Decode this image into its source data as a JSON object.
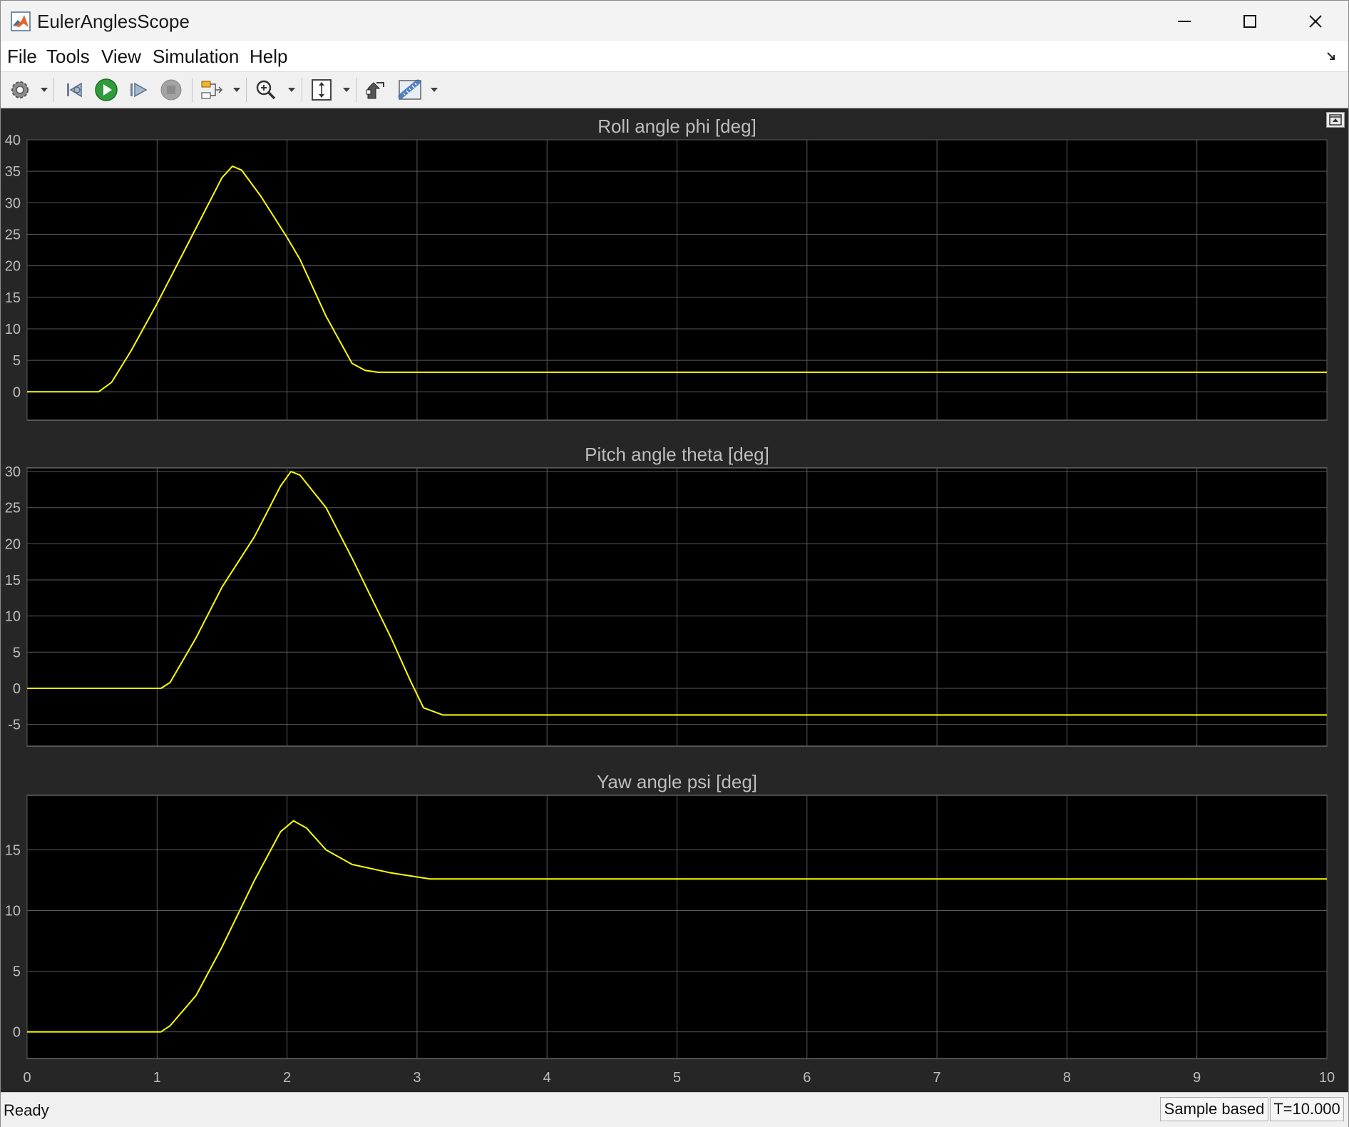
{
  "window": {
    "title": "EulerAnglesScope"
  },
  "menu": {
    "file": "File",
    "tools": "Tools",
    "view": "View",
    "simulation": "Simulation",
    "help": "Help"
  },
  "toolbar": {
    "items": [
      "settings-icon",
      "step-back-icon",
      "run-icon",
      "step-forward-icon",
      "stop-icon",
      "signal-select-icon",
      "zoom-icon",
      "scale-axes-icon",
      "highlight-block-icon",
      "measurements-icon"
    ]
  },
  "colors": {
    "signal": "#ffff00",
    "axes_bg": "#000000",
    "figure_bg": "#262626",
    "grid": "#5a5a5a",
    "text": "#bdbdbd"
  },
  "chart_data": [
    {
      "type": "line",
      "title": "Roll angle phi [deg]",
      "xlim": [
        0,
        10
      ],
      "ylim": [
        -4.5,
        40
      ],
      "yticks": [
        0,
        5,
        10,
        15,
        20,
        25,
        30,
        35,
        40
      ],
      "xticks": [
        0,
        1,
        2,
        3,
        4,
        5,
        6,
        7,
        8,
        9,
        10
      ],
      "grid": true,
      "x": [
        0,
        0.55,
        0.65,
        0.8,
        1.0,
        1.2,
        1.4,
        1.5,
        1.58,
        1.65,
        1.8,
        2.0,
        2.1,
        2.3,
        2.5,
        2.6,
        2.7,
        3.0,
        4.0,
        10.0
      ],
      "y": [
        0,
        0,
        1.5,
        6.5,
        14,
        22,
        30,
        34,
        35.8,
        35.2,
        31,
        24.5,
        21,
        12,
        4.5,
        3.4,
        3.1,
        3.1,
        3.1,
        3.1
      ]
    },
    {
      "type": "line",
      "title": "Pitch angle theta [deg]",
      "xlim": [
        0,
        10
      ],
      "ylim": [
        -8,
        30.5
      ],
      "yticks": [
        -5,
        0,
        5,
        10,
        15,
        20,
        25,
        30
      ],
      "xticks": [
        0,
        1,
        2,
        3,
        4,
        5,
        6,
        7,
        8,
        9,
        10
      ],
      "grid": true,
      "x": [
        0,
        1.03,
        1.1,
        1.3,
        1.5,
        1.75,
        1.95,
        2.03,
        2.1,
        2.3,
        2.5,
        2.8,
        2.95,
        3.05,
        3.2,
        4.0,
        10.0
      ],
      "y": [
        0,
        0,
        0.8,
        7,
        14,
        21,
        28,
        30,
        29.5,
        25,
        18,
        7,
        1,
        -2.7,
        -3.7,
        -3.7,
        -3.7
      ]
    },
    {
      "type": "line",
      "title": "Yaw angle psi [deg]",
      "xlim": [
        0,
        10
      ],
      "ylim": [
        -2.2,
        19.5
      ],
      "yticks": [
        0,
        5,
        10,
        15
      ],
      "xticks": [
        0,
        1,
        2,
        3,
        4,
        5,
        6,
        7,
        8,
        9,
        10
      ],
      "grid": true,
      "x": [
        0,
        1.03,
        1.1,
        1.3,
        1.5,
        1.75,
        1.95,
        2.05,
        2.15,
        2.3,
        2.5,
        2.8,
        3.1,
        4.0,
        10.0
      ],
      "y": [
        0,
        0,
        0.5,
        3,
        7,
        12.5,
        16.5,
        17.4,
        16.8,
        15.0,
        13.8,
        13.1,
        12.6,
        12.6,
        12.6
      ]
    }
  ],
  "status": {
    "text": "Ready",
    "mode": "Sample based",
    "time": "T=10.000"
  }
}
